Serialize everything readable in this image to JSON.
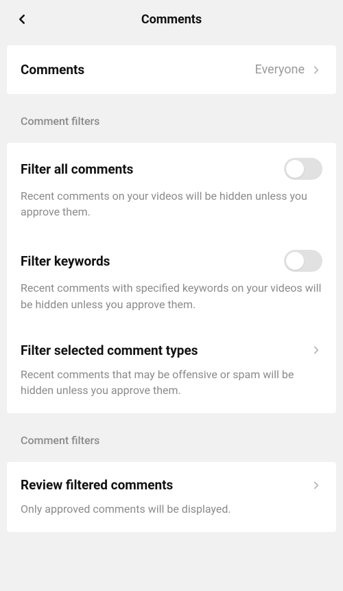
{
  "header": {
    "title": "Comments"
  },
  "comments_row": {
    "label": "Comments",
    "value": "Everyone"
  },
  "section1": {
    "title": "Comment filters",
    "items": [
      {
        "title": "Filter all comments",
        "desc": "Recent comments on your videos will be hidden unless you approve them."
      },
      {
        "title": "Filter keywords",
        "desc": "Recent comments with specified keywords on your videos will be hidden unless you approve them."
      },
      {
        "title": "Filter selected comment types",
        "desc": "Recent comments that may be offensive or spam will be hidden unless you approve them."
      }
    ]
  },
  "section2": {
    "title": "Comment filters",
    "item": {
      "title": "Review filtered comments",
      "desc": "Only approved comments will be displayed."
    }
  }
}
